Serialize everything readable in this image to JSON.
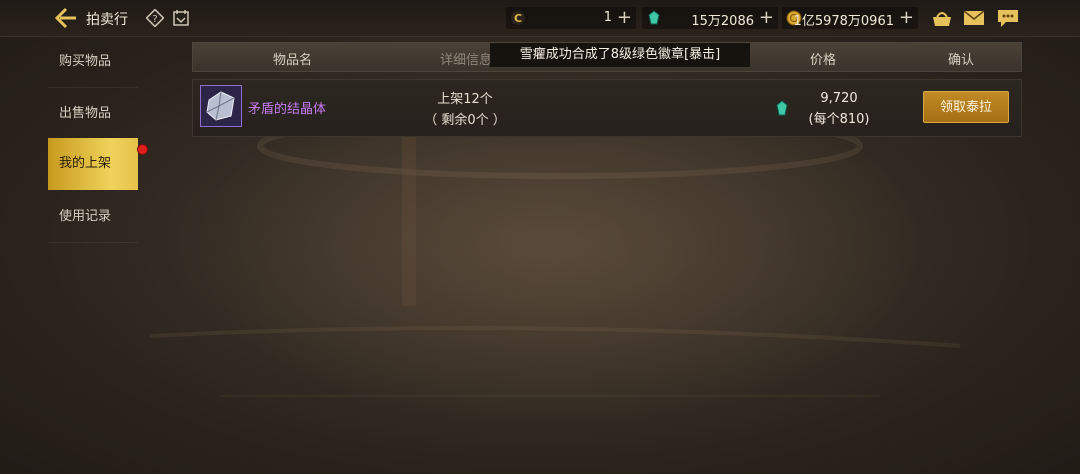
{
  "header": {
    "title": "拍卖行",
    "currencies": [
      {
        "icon": "coin-c-icon",
        "value": "1"
      },
      {
        "icon": "green-gem-icon",
        "value": "15万2086"
      },
      {
        "icon": "gold-coin-icon",
        "value": "1亿5978万0961"
      }
    ],
    "plus": "+"
  },
  "sidebar": {
    "items": [
      {
        "label": "购买物品"
      },
      {
        "label": "出售物品"
      },
      {
        "label": "我的上架"
      },
      {
        "label": "使用记录"
      }
    ]
  },
  "table": {
    "columns": {
      "name": "物品名",
      "detail": "详细信息",
      "price": "价格",
      "confirm": "确认"
    },
    "rows": [
      {
        "name": "矛盾的结晶体",
        "listed": "上架12个",
        "remaining": "（ 剩余0个 ）",
        "total": "9,720",
        "unit": "(每个810)",
        "action": "领取泰拉"
      }
    ]
  },
  "toast": {
    "text": "雪癯成功合成了8级绿色徽章[暴击]"
  },
  "colors": {
    "accent": "#c08a25",
    "item_name": "#c77cf2",
    "active_tab": "#f0d25a",
    "badge": "#e0211a"
  }
}
